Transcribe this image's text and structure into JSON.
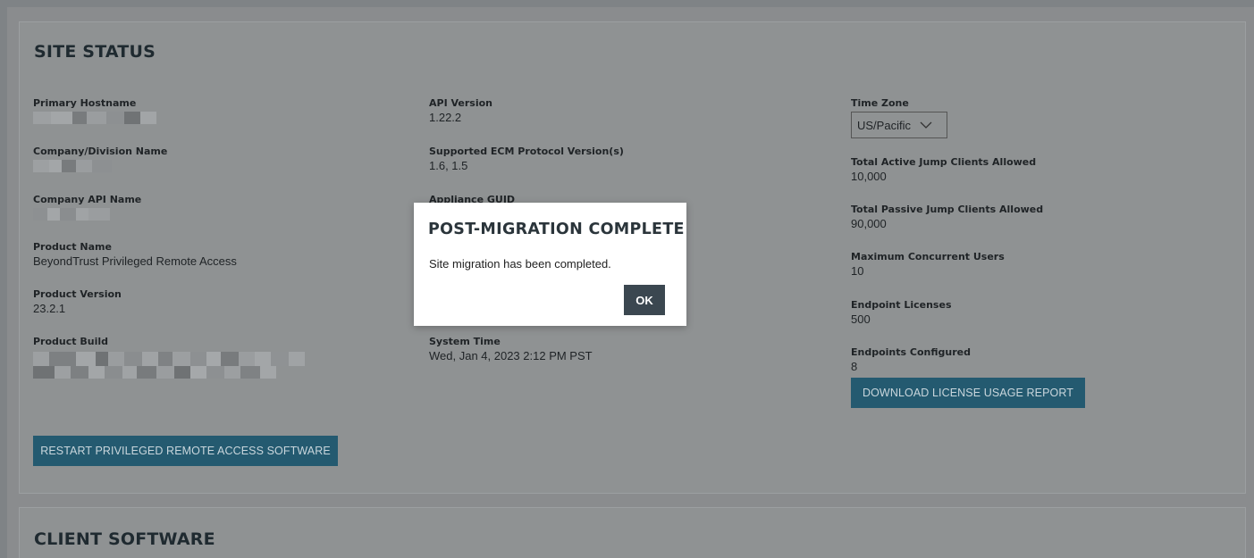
{
  "site_status": {
    "title": "SITE STATUS",
    "col1": {
      "primary_hostname_label": "Primary Hostname",
      "company_division_label": "Company/Division Name",
      "company_api_label": "Company API Name",
      "product_name_label": "Product Name",
      "product_name_value": "BeyondTrust Privileged Remote Access",
      "product_version_label": "Product Version",
      "product_version_value": "23.2.1",
      "product_build_label": "Product Build"
    },
    "col2": {
      "api_version_label": "API Version",
      "api_version_value": "1.22.2",
      "ecm_label": "Supported ECM Protocol Version(s)",
      "ecm_value": "1.6, 1.5",
      "appliance_guid_label": "Appliance GUID",
      "system_time_label": "System Time",
      "system_time_value": "Wed, Jan 4, 2023 2:12 PM PST"
    },
    "col3": {
      "time_zone_label": "Time Zone",
      "time_zone_value": "US/Pacific",
      "active_jump_label": "Total Active Jump Clients Allowed",
      "active_jump_value": "10,000",
      "passive_jump_label": "Total Passive Jump Clients Allowed",
      "passive_jump_value": "90,000",
      "max_users_label": "Maximum Concurrent Users",
      "max_users_value": "10",
      "endpoint_licenses_label": "Endpoint Licenses",
      "endpoint_licenses_value": "500",
      "endpoints_configured_label": "Endpoints Configured",
      "endpoints_configured_value": "8"
    },
    "download_button": "DOWNLOAD LICENSE USAGE REPORT",
    "restart_button": "RESTART PRIVILEGED REMOTE ACCESS SOFTWARE"
  },
  "client_software": {
    "title": "CLIENT SOFTWARE"
  },
  "modal": {
    "title": "POST-MIGRATION COMPLETE",
    "message": "Site migration has been completed.",
    "ok_label": "OK"
  },
  "colors": {
    "overlay": "#8a8c8e",
    "button": "#245a70",
    "modal_bg": "#ffffff",
    "ok_button": "#3b4750"
  }
}
